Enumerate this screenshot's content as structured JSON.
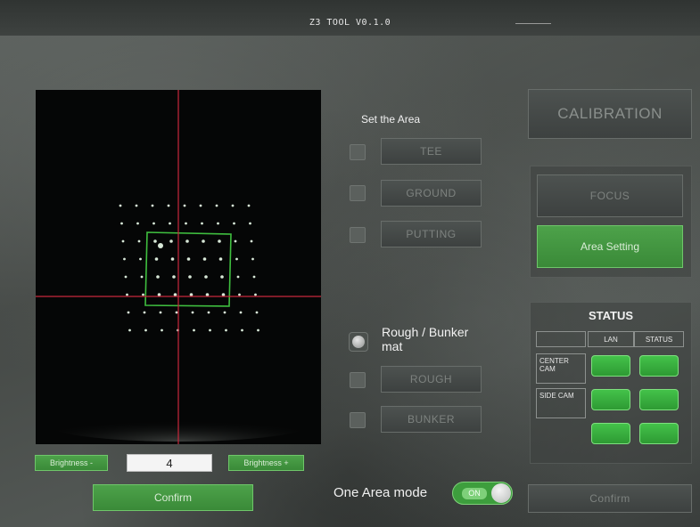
{
  "app": {
    "title": "Z3 TOOL V0.1.0"
  },
  "area": {
    "heading": "Set the Area",
    "buttons": [
      {
        "label": "TEE",
        "checked": false
      },
      {
        "label": "GROUND",
        "checked": false
      },
      {
        "label": "PUTTING",
        "checked": false
      }
    ]
  },
  "mat": {
    "label": "Rough / Bunker mat",
    "buttons": [
      {
        "label": "ROUGH",
        "checked": false
      },
      {
        "label": "BUNKER",
        "checked": false
      }
    ]
  },
  "right_panel": {
    "calibration": "CALIBRATION",
    "focus": "FOCUS",
    "area_setting": "Area Setting"
  },
  "status": {
    "title": "STATUS",
    "col_lan": "LAN",
    "col_status": "STATUS",
    "rows": [
      {
        "label": "CENTER CAM",
        "lan": "ok",
        "status": "ok"
      },
      {
        "label": "SIDE CAM",
        "lan": "ok",
        "status": "ok"
      },
      {
        "label": "",
        "lan": "ok",
        "status": "ok"
      }
    ],
    "ok_color": "#3db442"
  },
  "camera": {
    "brightness_minus": "Brightness -",
    "value": "4",
    "brightness_plus": "Brightness +",
    "confirm": "Confirm"
  },
  "one_area": {
    "label": "One Area mode",
    "state": "ON"
  },
  "confirm_right": "Confirm",
  "colors": {
    "accent_green": "#46a044",
    "crosshair": "#c8283c",
    "marker_box": "#3fbf3f"
  }
}
